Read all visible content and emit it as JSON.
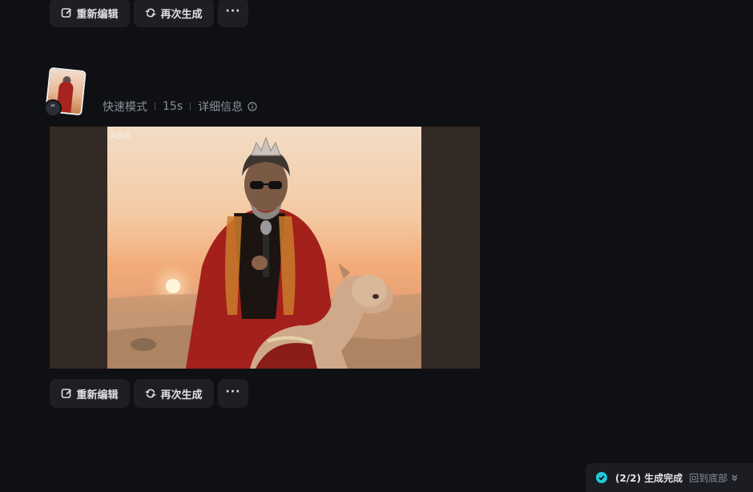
{
  "toolbar_top": {
    "reedit_label": "重新编辑",
    "regenerate_label": "再次生成",
    "more_label": "···"
  },
  "result": {
    "mode": "快速模式",
    "duration": "15s",
    "details_label": "详细信息",
    "quote_mark": "“",
    "image_watermark": "AI生成"
  },
  "toolbar_bottom": {
    "reedit_label": "重新编辑",
    "regenerate_label": "再次生成",
    "more_label": "···"
  },
  "toast": {
    "status": "(2/2) 生成完成",
    "back_to_bottom": "回到底部"
  },
  "colors": {
    "background": "#0f1014",
    "button_bg": "#1e1f25",
    "accent": "#1fc9d8"
  }
}
